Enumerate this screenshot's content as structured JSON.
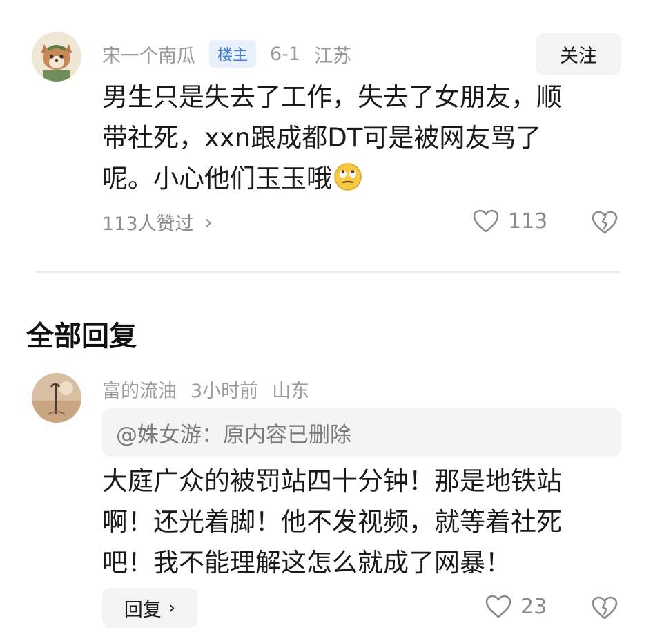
{
  "top_comment": {
    "username": "宋一个南瓜",
    "badge": "楼主",
    "date": "6-1",
    "location": "江苏",
    "follow_label": "关注",
    "text_lines": [
      "男生只是失去了工作，失去了女朋友，顺",
      "带社死，xxn跟成都DT可是被网友骂了",
      "呢。小心他们玉玉哦"
    ],
    "emoji": "eye-roll-emoji",
    "likes_summary": "113人赞过",
    "like_count": "113"
  },
  "section": {
    "title": "全部回复"
  },
  "reply": {
    "username": "富的流油",
    "time": "3小时前",
    "location": "山东",
    "quote": "@姝女游：原内容已删除",
    "text_lines": [
      "大庭广众的被罚站四十分钟！那是地铁站",
      "啊！还光着脚！他不发视频，就等着社死",
      "吧！我不能理解这怎么就成了网暴！"
    ],
    "reply_label": "回复",
    "like_count": "23"
  },
  "colors": {
    "badge_bg": "#e8f0fb",
    "badge_text": "#3f7fd6",
    "meta_gray": "#9a9a9a",
    "button_bg": "#f3f3f3"
  }
}
